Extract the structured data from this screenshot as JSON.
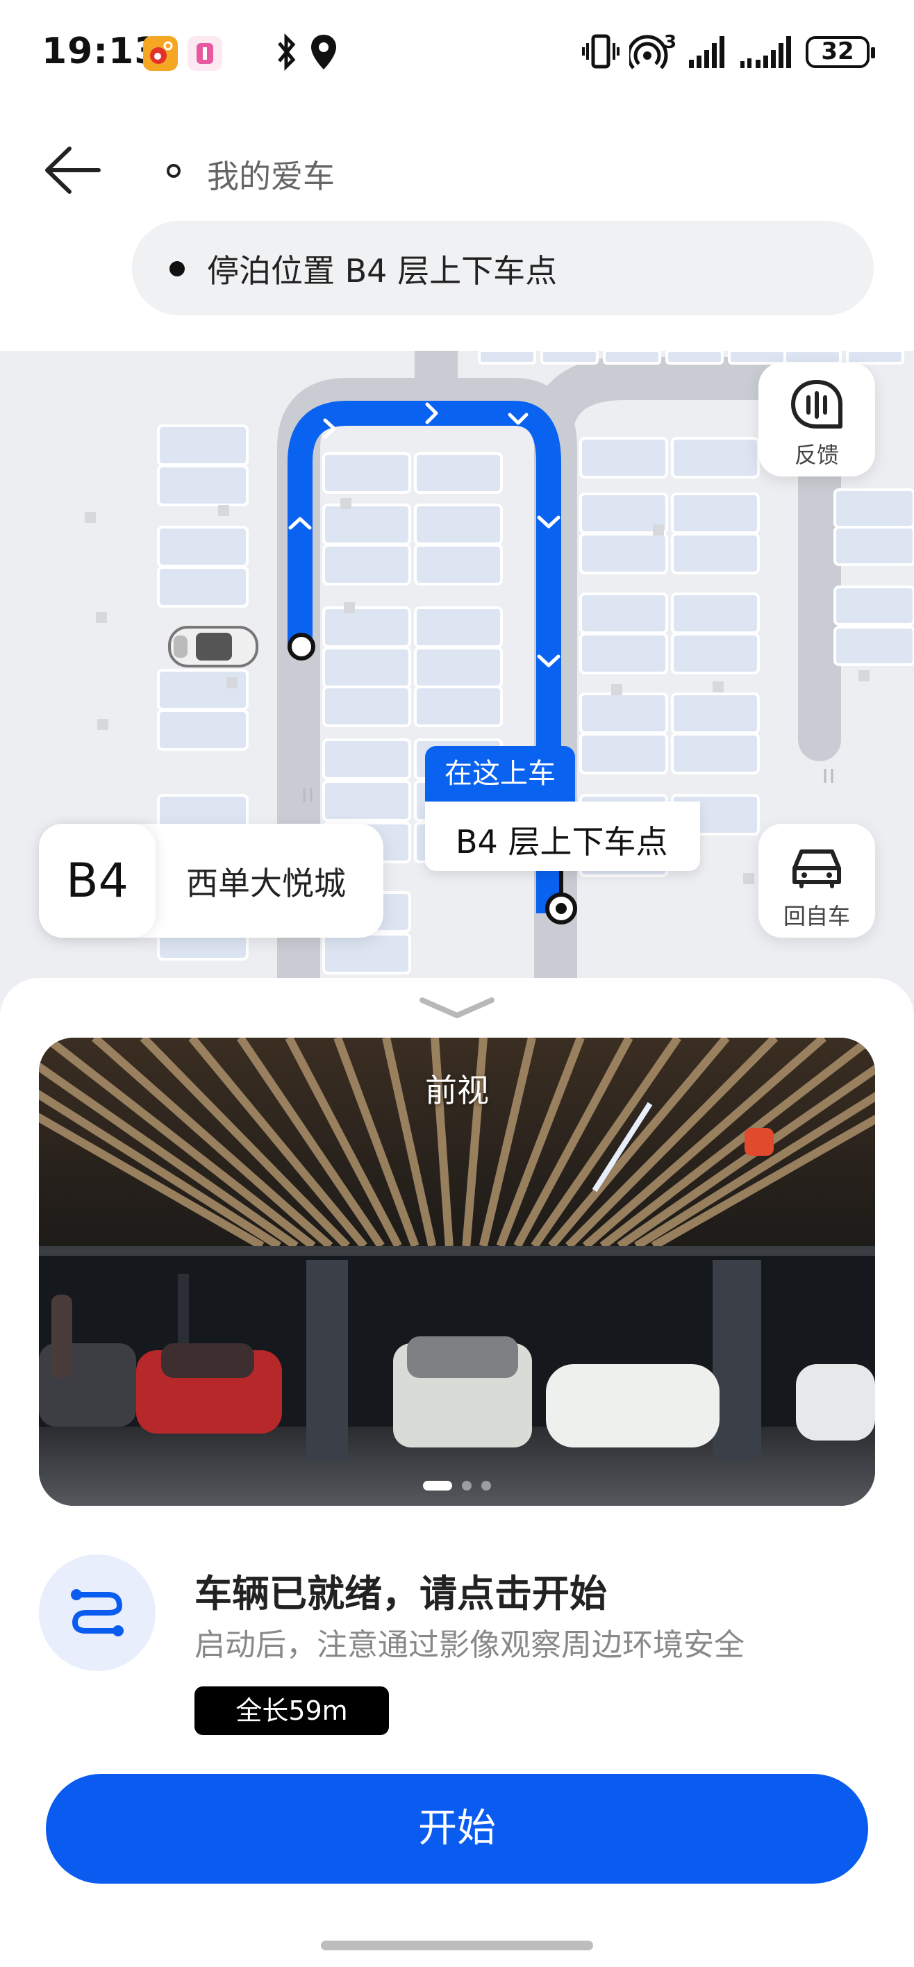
{
  "status_bar": {
    "time": "19:13",
    "battery": "32",
    "signal_super": "3",
    "icons": [
      "weibo-app-icon",
      "app-notification-icon",
      "bluetooth-icon",
      "location-icon",
      "vibrate-icon",
      "hotspot-icon",
      "signal-icon",
      "signal-icon-2",
      "battery-icon"
    ]
  },
  "header": {
    "origin_label": "我的爱车",
    "destination_label": "停泊位置 B4 层上下车点"
  },
  "map": {
    "feedback_label": "反馈",
    "return_label": "回自车",
    "floor": "B4",
    "mall_name": "西单大悦城",
    "pickup_tag": "在这上车",
    "pickup_point": "B4 层上下车点",
    "route_color": "#0a63f0"
  },
  "camera": {
    "label": "前视",
    "page_count": 3,
    "active_page": 0
  },
  "status_panel": {
    "title": "车辆已就绪，请点击开始",
    "subtitle": "启动后，注意通过影像观察周边环境安全",
    "length": "全长59m"
  },
  "action": {
    "start_label": "开始",
    "accent": "#0a5cf0"
  }
}
